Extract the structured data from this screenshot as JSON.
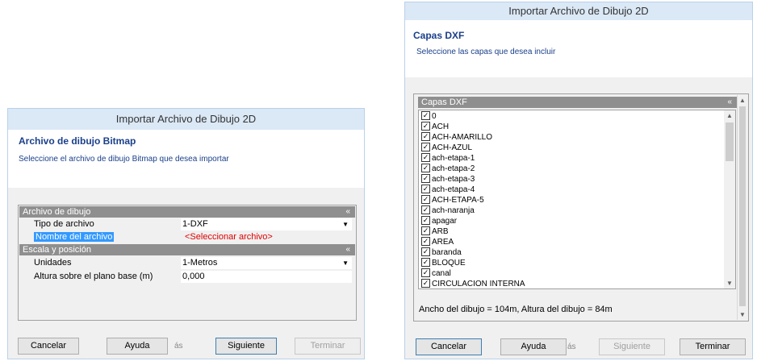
{
  "left_window": {
    "title": "Importar Archivo de Dibujo 2D",
    "heading": "Archivo de dibujo Bitmap",
    "subtitle": "Seleccione el archivo de dibujo Bitmap que desea importar",
    "sections": {
      "file": {
        "label": "Archivo de dibujo",
        "rows": [
          {
            "label": "Tipo de archivo",
            "value": "1-DXF"
          },
          {
            "label": "Nombre del archivo",
            "value": "<Seleccionar archivo>"
          }
        ]
      },
      "scale": {
        "label": "Escala y posición",
        "rows": [
          {
            "label": "Unidades",
            "value": "1-Metros"
          },
          {
            "label": "Altura sobre el plano base (m)",
            "value": "0,000"
          }
        ]
      }
    },
    "buttons": {
      "cancel": "Cancelar",
      "help": "Ayuda",
      "ghost": "ás",
      "next": "Siguiente",
      "finish": "Terminar"
    }
  },
  "right_window": {
    "title": "Importar Archivo de Dibujo 2D",
    "heading": "Capas DXF",
    "subtitle": "Seleccione las capas que desea incluir",
    "list_header": "Capas DXF",
    "layers": [
      "0",
      "ACH",
      "ACH-AMARILLO",
      "ACH-AZUL",
      "ach-etapa-1",
      "ach-etapa-2",
      "ach-etapa-3",
      "ach-etapa-4",
      "ACH-ETAPA-5",
      "ach-naranja",
      "apagar",
      "ARB",
      "AREA",
      "baranda",
      "BLOQUE",
      "canal",
      "CIRCULACION INTERNA"
    ],
    "info": "Ancho del dibujo = 104m, Altura del dibujo = 84m",
    "buttons": {
      "cancel": "Cancelar",
      "help": "Ayuda",
      "ghost": "ás",
      "next": "Siguiente",
      "finish": "Terminar"
    }
  },
  "icons": {
    "check": "check-icon",
    "chevron": "double-chevron-icon",
    "dropdown": "dropdown-arrow-icon"
  }
}
